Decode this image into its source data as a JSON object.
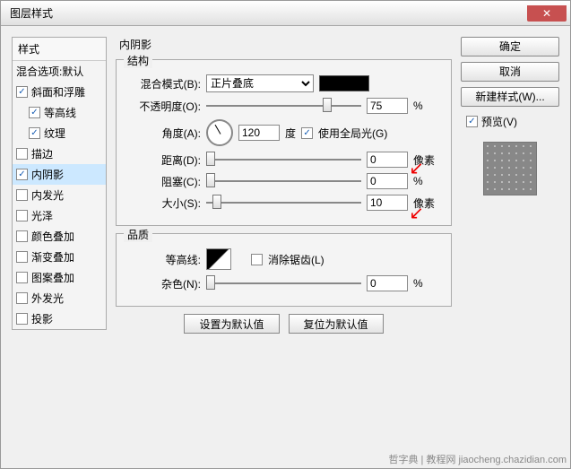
{
  "window": {
    "title": "图层样式"
  },
  "leftPanel": {
    "header": "样式",
    "blendOptions": "混合选项:默认",
    "items": [
      {
        "label": "斜面和浮雕",
        "checked": true,
        "sub": false
      },
      {
        "label": "等高线",
        "checked": true,
        "sub": true
      },
      {
        "label": "纹理",
        "checked": true,
        "sub": true
      },
      {
        "label": "描边",
        "checked": false,
        "sub": false
      },
      {
        "label": "内阴影",
        "checked": true,
        "sub": false,
        "selected": true
      },
      {
        "label": "内发光",
        "checked": false,
        "sub": false
      },
      {
        "label": "光泽",
        "checked": false,
        "sub": false
      },
      {
        "label": "颜色叠加",
        "checked": false,
        "sub": false
      },
      {
        "label": "渐变叠加",
        "checked": false,
        "sub": false
      },
      {
        "label": "图案叠加",
        "checked": false,
        "sub": false
      },
      {
        "label": "外发光",
        "checked": false,
        "sub": false
      },
      {
        "label": "投影",
        "checked": false,
        "sub": false
      }
    ]
  },
  "effect": {
    "title": "内阴影",
    "structure": {
      "header": "结构",
      "blendModeLabel": "混合模式(B):",
      "blendModeValue": "正片叠底",
      "opacityLabel": "不透明度(O):",
      "opacityValue": "75",
      "opacityUnit": "%",
      "angleLabel": "角度(A):",
      "angleValue": "120",
      "angleUnit": "度",
      "globalLightLabel": "使用全局光(G)",
      "globalLightChecked": true,
      "distanceLabel": "距离(D):",
      "distanceValue": "0",
      "distanceUnit": "像素",
      "chokeLabel": "阻塞(C):",
      "chokeValue": "0",
      "chokeUnit": "%",
      "sizeLabel": "大小(S):",
      "sizeValue": "10",
      "sizeUnit": "像素"
    },
    "quality": {
      "header": "品质",
      "contourLabel": "等高线:",
      "antiAliasLabel": "消除锯齿(L)",
      "antiAliasChecked": false,
      "noiseLabel": "杂色(N):",
      "noiseValue": "0",
      "noiseUnit": "%"
    },
    "buttons": {
      "makeDefault": "设置为默认值",
      "resetDefault": "复位为默认值"
    }
  },
  "rightPanel": {
    "ok": "确定",
    "cancel": "取消",
    "newStyle": "新建样式(W)...",
    "previewLabel": "预览(V)",
    "previewChecked": true
  },
  "watermark": "哲字典 | 教程网  jiaocheng.chazidian.com"
}
